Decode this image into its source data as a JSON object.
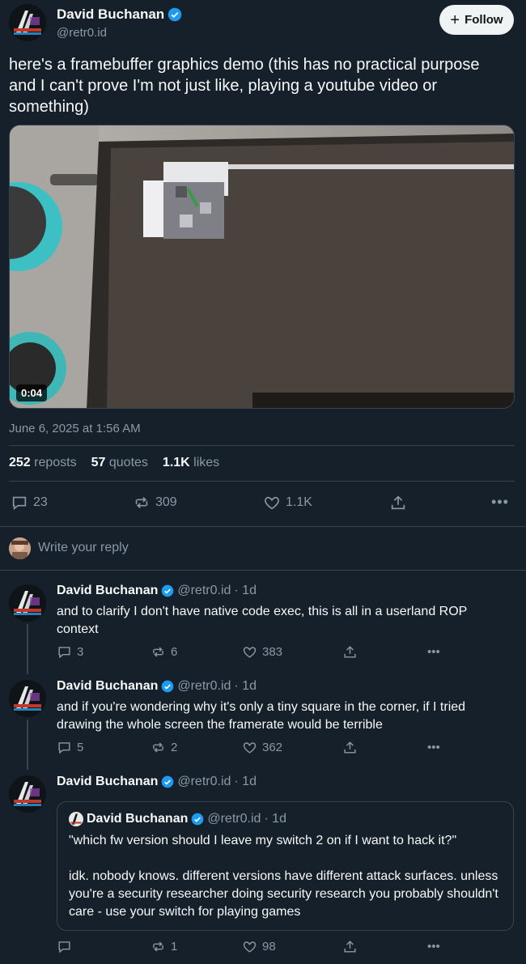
{
  "tweet": {
    "author_name": "David Buchanan",
    "author_handle": "@retr0.id",
    "follow_label": "Follow",
    "text": "here's a framebuffer graphics demo (this has no practical purpose and I can't prove I'm not just like, playing a youtube video or something)",
    "video_duration": "0:04",
    "timestamp": "June 6, 2025 at 1:56 AM",
    "stats": {
      "reposts_count": "252",
      "reposts_label": "reposts",
      "quotes_count": "57",
      "quotes_label": "quotes",
      "likes_count": "1.1K",
      "likes_label": "likes"
    },
    "actions": {
      "replies": "23",
      "reposts": "309",
      "likes": "1.1K"
    }
  },
  "reply_prompt": "Write your reply",
  "replies": [
    {
      "author_name": "David Buchanan",
      "author_handle": "@retr0.id",
      "time": "· 1d",
      "text": "and to clarify I don't have native code exec, this is all in a userland ROP context",
      "replies": "3",
      "reposts": "6",
      "likes": "383"
    },
    {
      "author_name": "David Buchanan",
      "author_handle": "@retr0.id",
      "time": "· 1d",
      "text": "and if you're wondering why it's only a tiny square in the corner, if I tried drawing the whole screen the framerate would be terrible",
      "replies": "5",
      "reposts": "2",
      "likes": "362"
    },
    {
      "author_name": "David Buchanan",
      "author_handle": "@retr0.id",
      "time": "· 1d",
      "quote": {
        "author_name": "David Buchanan",
        "author_handle": "@retr0.id",
        "time": "· 1d",
        "line1": "\"which fw version should I leave my switch 2 on if I want to hack it?\"",
        "line2": "idk. nobody knows. different versions have different attack surfaces. unless you're a security researcher doing security research you probably shouldn't care - use your switch for playing games"
      },
      "replies": "",
      "reposts": "1",
      "likes": "98"
    }
  ],
  "colors": {
    "background": "#15202b",
    "text": "#f7f9f9",
    "muted": "#8b98a5",
    "verified": "#1d9bf0",
    "divider": "#38444d"
  }
}
